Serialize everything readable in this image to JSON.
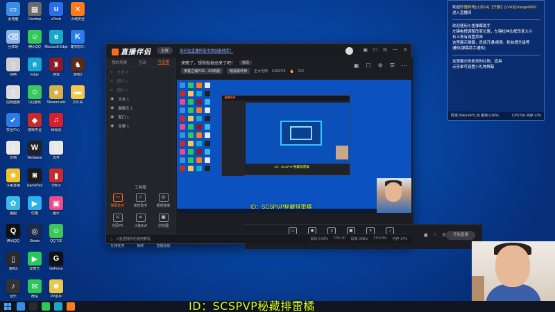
{
  "desktop": {
    "icons": [
      {
        "label": "此电脑",
        "color": "#3b8ee8",
        "glyph": "▭",
        "col": 0,
        "row": 0
      },
      {
        "label": "Desktop",
        "color": "#6a6a6a",
        "glyph": "▦",
        "col": 1,
        "row": 0
      },
      {
        "label": "uTools",
        "color": "#2a6ee8",
        "glyph": "u",
        "col": 2,
        "row": 0
      },
      {
        "label": "火绒安全",
        "color": "#ff7a1a",
        "glyph": "✕",
        "col": 3,
        "row": 0
      },
      {
        "label": "回收站",
        "color": "#8ab4e8",
        "glyph": "⌫",
        "col": 0,
        "row": 1
      },
      {
        "label": "腾讯QQ",
        "color": "#33c85a",
        "glyph": "☺",
        "col": 1,
        "row": 1
      },
      {
        "label": "Microsoft Edge",
        "color": "#1aa8c8",
        "glyph": "e",
        "col": 2,
        "row": 1
      },
      {
        "label": "酷狗音乐",
        "color": "#2a7ae8",
        "glyph": "K",
        "col": 3,
        "row": 1
      },
      {
        "label": "网络",
        "color": "#cfcfcf",
        "glyph": "▯",
        "col": 0,
        "row": 2
      },
      {
        "label": "Edge",
        "color": "#18a6d2",
        "glyph": "e",
        "col": 1,
        "row": 2
      },
      {
        "label": "游戏",
        "color": "#8b1a2a",
        "glyph": "♜",
        "col": 2,
        "row": 2
      },
      {
        "label": "游戏2",
        "color": "#5a2a1a",
        "glyph": "♞",
        "col": 3,
        "row": 2
      },
      {
        "label": "控制面板",
        "color": "#dcdcdc",
        "glyph": "▯",
        "col": 0,
        "row": 3
      },
      {
        "label": "QQ游戏",
        "color": "#3ac85a",
        "glyph": "☺",
        "col": 1,
        "row": 3
      },
      {
        "label": "StreamLabs",
        "color": "#d8b04a",
        "glyph": "★",
        "col": 2,
        "row": 3
      },
      {
        "label": "文件夹",
        "color": "#f2c94c",
        "glyph": "▬",
        "col": 3,
        "row": 3
      },
      {
        "label": "安全中心",
        "color": "#2a7ae8",
        "glyph": "✔",
        "col": 0,
        "row": 4
      },
      {
        "label": "游戏平台",
        "color": "#c82a2a",
        "glyph": "◆",
        "col": 1,
        "row": 4
      },
      {
        "label": "网易云",
        "color": "#d81e2a",
        "glyph": "♫",
        "col": 2,
        "row": 4
      },
      {
        "label": "文档",
        "color": "#e8e8e8",
        "glyph": "▯",
        "col": 0,
        "row": 5
      },
      {
        "label": "WeGame",
        "color": "#222",
        "glyph": "W",
        "col": 1,
        "row": 5
      },
      {
        "label": "文件",
        "color": "#e8e8e8",
        "glyph": "▯",
        "col": 2,
        "row": 5
      },
      {
        "label": "斗鱼直播",
        "color": "#f2c12a",
        "glyph": "☻",
        "col": 0,
        "row": 6
      },
      {
        "label": "GamePad",
        "color": "#1a1a1a",
        "glyph": "◙",
        "col": 1,
        "row": 6
      },
      {
        "label": "Office",
        "color": "#c82a2a",
        "glyph": "▮",
        "col": 2,
        "row": 6
      },
      {
        "label": "画图",
        "color": "#3ab8e8",
        "glyph": "✿",
        "col": 0,
        "row": 7
      },
      {
        "label": "优酷",
        "color": "#2ab0f0",
        "glyph": "▶",
        "col": 1,
        "row": 7
      },
      {
        "label": "图片",
        "color": "#e84a8a",
        "glyph": "▣",
        "col": 2,
        "row": 7
      },
      {
        "label": "腾讯QQ",
        "color": "#111",
        "glyph": "Q",
        "col": 0,
        "row": 8
      },
      {
        "label": "Steam",
        "color": "#1b2a4a",
        "glyph": "◎",
        "col": 1,
        "row": 8
      },
      {
        "label": "QQ飞车",
        "color": "#3ac85a",
        "glyph": "☺",
        "col": 2,
        "row": 8
      },
      {
        "label": "游戏3",
        "color": "#2a2a2a",
        "glyph": "▯",
        "col": 0,
        "row": 9
      },
      {
        "label": "爱奇艺",
        "color": "#2ac85a",
        "glyph": "▶",
        "col": 1,
        "row": 9
      },
      {
        "label": "GeForce",
        "color": "#111",
        "glyph": "G",
        "col": 2,
        "row": 9
      },
      {
        "label": "音乐",
        "color": "#333",
        "glyph": "♪",
        "col": 0,
        "row": 10
      },
      {
        "label": "微信",
        "color": "#2ac85a",
        "glyph": "✉",
        "col": 1,
        "row": 10
      },
      {
        "label": "PP助手",
        "color": "#e8c84a",
        "glyph": "☻",
        "col": 2,
        "row": 10
      }
    ]
  },
  "info_panel": {
    "line1_prefix": "欢迎",
    "line1_user": "秒懂帅哥[火焰14]【子爵】[LV43]Orange0000",
    "line1_suffix": "进入直播间",
    "help": [
      "欢迎使用斗鱼弹幕助手",
      "左键拖拽调整改变位置，左键拉伸边框改变大小",
      "右上角有设置菜单",
      "这里展示弹幕，贵族开通/续费、粉丝牌升级等",
      "通知(弹幕助手通知)"
    ],
    "gift_lines": [
      "这里展示你收到的礼物、道具",
      "点亲单可设置小礼物屏蔽"
    ],
    "status_left": "码率 554/s FPS 30 丢帧 0.00%",
    "status_right": "CPU 5% 内存 17%"
  },
  "app": {
    "logo": "直播伴侣",
    "mode_pill": "全屏",
    "notice": "如何在直播伴侣中添加素材库？",
    "window_controls": [
      "▣",
      "☐",
      "⊟",
      "—",
      "✕"
    ],
    "sidebar_tabs": [
      {
        "label": "我的场景",
        "active": false
      },
      {
        "label": "互动",
        "active": false
      },
      {
        "label": "可直播",
        "active": true
      }
    ],
    "layers": [
      {
        "label": "文本 2",
        "visible": false
      },
      {
        "label": "图片 1",
        "visible": false
      },
      {
        "label": "图片 2",
        "visible": false
      },
      {
        "label": "文本 1",
        "visible": true
      },
      {
        "label": "摄像头 1",
        "visible": true
      },
      {
        "label": "窗口 1",
        "visible": true
      },
      {
        "label": "全屏 1",
        "visible": true
      }
    ],
    "toolbox_title": "工具箱",
    "tools": [
      {
        "label": "弹幕助手",
        "glyph": "▭",
        "active": true
      },
      {
        "label": "房管助手",
        "glyph": "☺",
        "active": false
      },
      {
        "label": "视频连麦",
        "glyph": "◎",
        "active": false
      },
      {
        "label": "全民PK",
        "glyph": "⚔",
        "active": false
      },
      {
        "label": "斗鱼Buff",
        "glyph": "∞",
        "active": false
      },
      {
        "label": "浏览器",
        "glyph": "▣",
        "active": false
      },
      {
        "label": "礼物任务",
        "glyph": "♥",
        "active": false
      },
      {
        "label": "抽奖",
        "glyph": "⊘",
        "active": false
      },
      {
        "label": "直播贴纸",
        "glyph": "▤",
        "active": false
      }
    ],
    "stream_title": "来晚了，想你就抽出来了吧！",
    "edit_label": "修改",
    "category": "英雄之魂POE · SD新服",
    "sub_category": "暗黑破坏神",
    "right_arrow": "正大光明",
    "room_id": "6160078",
    "viewers": "212",
    "head_icons": [
      "▣",
      "☐",
      "⚙",
      "☰",
      "⋯"
    ],
    "preview_id_text": "ID：SCSPVP秘藏排雷橘",
    "nested_title": "直播伴侣",
    "nested_id_text": "ID：SCSPVP秘藏排雷橘",
    "controls": [
      {
        "label": "直播屏幕",
        "glyph": "▭"
      },
      {
        "label": "摄像头",
        "glyph": "◉"
      },
      {
        "label": "手机投屏",
        "glyph": "▯"
      },
      {
        "label": "多媒体",
        "glyph": "▣"
      },
      {
        "label": "麦克风",
        "glyph": "⌽"
      },
      {
        "label": "扬声器",
        "glyph": "♪"
      }
    ],
    "start_label": "开始直播",
    "status_warn": "△",
    "status_msg": "斗鱼直播伴侣使用教程",
    "status_stats": [
      "丢帧 0.00%",
      "FPS 30",
      "码率 0KB/s",
      "CPU 5%",
      "内存 17%"
    ]
  },
  "overlay_id": "ID：SCSPVP秘藏排雷橘",
  "colors": {
    "accent": "#ff6a1f",
    "id_text": "#d8ff2a",
    "desktop_bg": "#0848a8"
  }
}
